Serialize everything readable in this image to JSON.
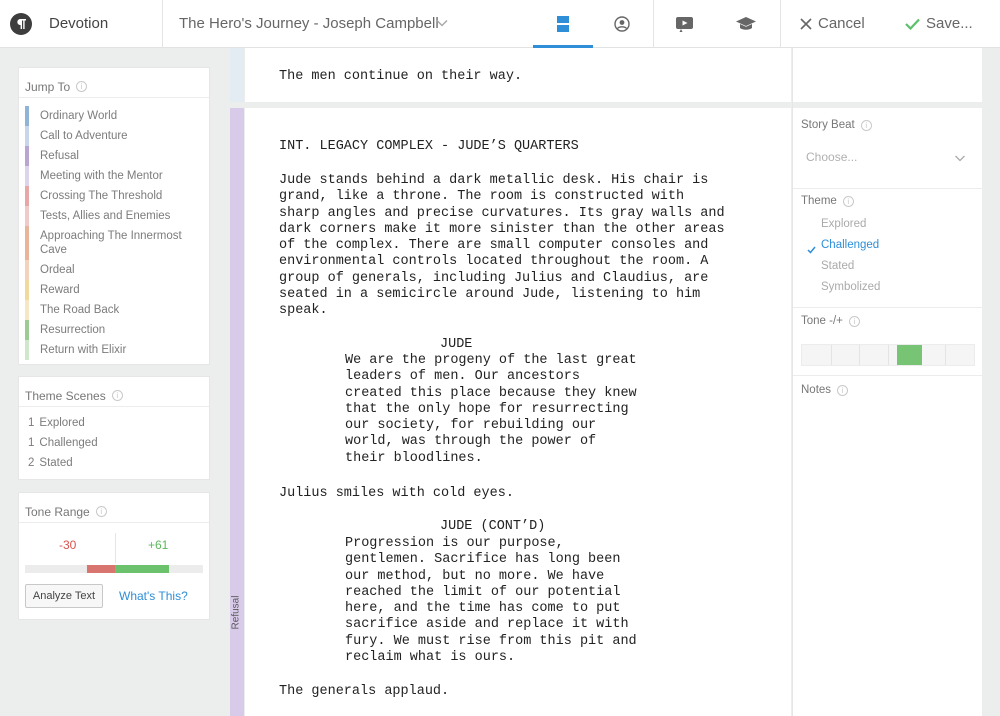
{
  "app": {
    "name": "Devotion"
  },
  "document": {
    "title": "The Hero's Journey - Joseph Campbell"
  },
  "toolbar": {
    "cancel_label": "Cancel",
    "save_label": "Save..."
  },
  "colors": {
    "accent": "#2e8ed8",
    "save": "#5cbf6a",
    "negative": "#d9534f",
    "positive": "#5cb85c"
  },
  "jump_to": {
    "title": "Jump To",
    "items": [
      {
        "label": "Ordinary World",
        "color": "#8fb4d6"
      },
      {
        "label": "Call to Adventure",
        "color": "#c8d6ea"
      },
      {
        "label": "Refusal",
        "color": "#b9a4d2"
      },
      {
        "label": "Meeting with the Mentor",
        "color": "#ddd3ea"
      },
      {
        "label": "Crossing The Threshold",
        "color": "#e7a7a7"
      },
      {
        "label": "Tests, Allies and Enemies",
        "color": "#f0c9c9"
      },
      {
        "label": "Approaching The Innermost Cave",
        "color": "#e8b59b"
      },
      {
        "label": "Ordeal",
        "color": "#f3d3bb"
      },
      {
        "label": "Reward",
        "color": "#f1da9c"
      },
      {
        "label": "The Road Back",
        "color": "#f5e7c4"
      },
      {
        "label": "Resurrection",
        "color": "#9ccc93"
      },
      {
        "label": "Return with Elixir",
        "color": "#cfe8c9"
      }
    ]
  },
  "theme_scenes": {
    "title": "Theme Scenes",
    "rows": [
      {
        "count": "1",
        "label": "Explored"
      },
      {
        "count": "1",
        "label": "Challenged"
      },
      {
        "count": "2",
        "label": "Stated"
      }
    ]
  },
  "tone_range": {
    "title": "Tone Range",
    "min": "-30",
    "max": "+61",
    "min_value": -30,
    "max_value": 61,
    "analyze_label": "Analyze Text",
    "whats_this_label": "What's This?"
  },
  "script": {
    "prev_line": "The men continue on their way.",
    "beat_label": "Refusal",
    "slug": "INT. LEGACY COMPLEX - JUDE’S QUARTERS",
    "action1": "Jude stands behind a dark metallic desk. His chair is\ngrand, like a throne. The room is constructed with\nsharp angles and precise curvatures. Its gray walls and\ndark corners make it more sinister than the other areas\nof the complex. There are small computer consoles and\nenvironmental controls located throughout the room. A\ngroup of generals, including Julius and Claudius, are\nseated in a semicircle around Jude, listening to him\nspeak.",
    "char1": "JUDE",
    "dialog1": "We are the progeny of the last great\nleaders of men. Our ancestors\ncreated this place because they knew\nthat the only hope for resurrecting\nour society, for rebuilding our\nworld, was through the power of\ntheir bloodlines.",
    "action2": "Julius smiles with cold eyes.",
    "char2": "JUDE (CONT’D)",
    "dialog2": "Progression is our purpose,\ngentlemen. Sacrifice has long been\nour method, but no more. We have\nreached the limit of our potential\nhere, and the time has come to put\nsacrifice aside and replace it with\nfury. We must rise from this pit and\nreclaim what is ours.",
    "action3": "The generals applaud."
  },
  "right_panel": {
    "story_beat_label": "Story Beat",
    "story_beat_placeholder": "Choose...",
    "theme_label": "Theme",
    "theme_options": [
      "Explored",
      "Challenged",
      "Stated",
      "Symbolized"
    ],
    "theme_selected": "Challenged",
    "tone_label": "Tone -/+",
    "tone_value_range": [
      10,
      40
    ],
    "notes_label": "Notes"
  }
}
